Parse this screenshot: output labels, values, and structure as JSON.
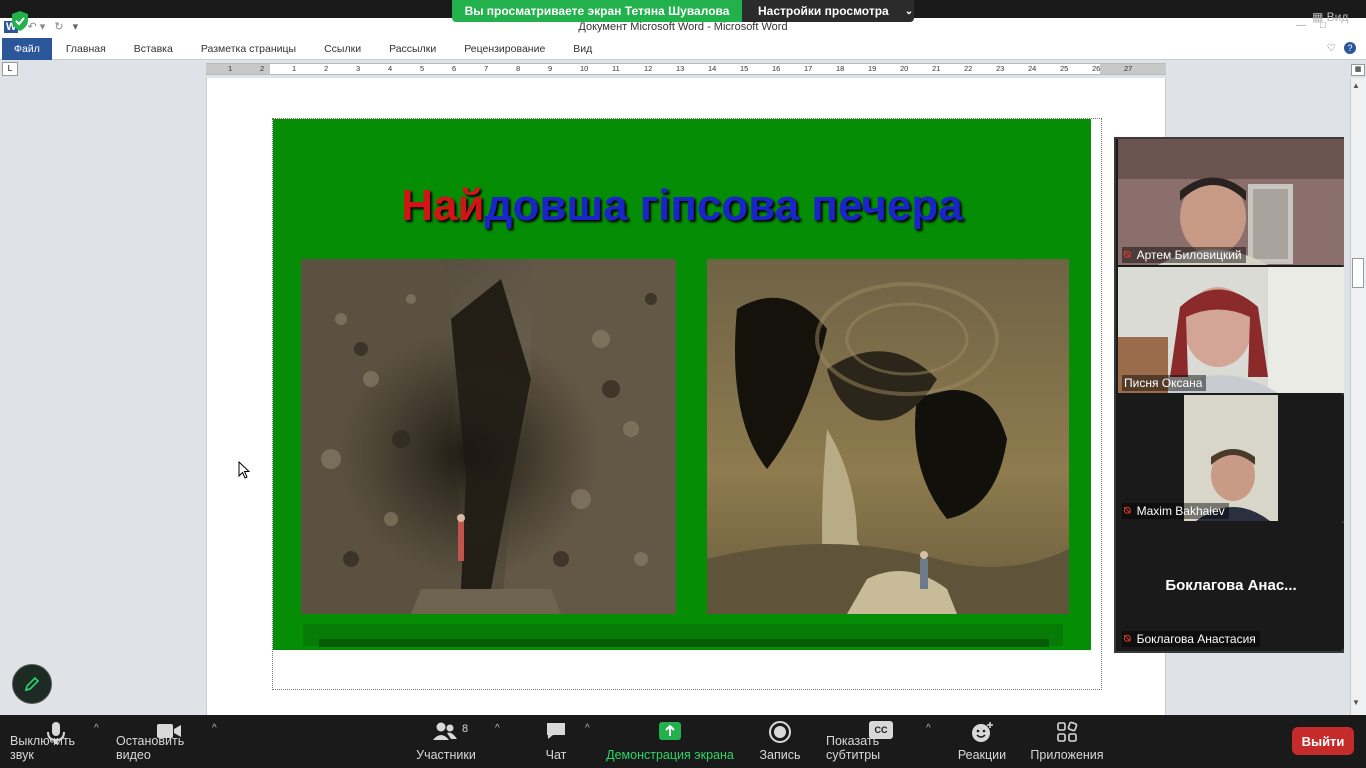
{
  "zoom": {
    "banner": {
      "sharing_text": "Вы просматриваете экран Тетяна Шувалова",
      "view_options": "Настройки просмотра",
      "view_label": "Вид"
    },
    "toolbar": {
      "mute": "Выключить звук",
      "stop_video": "Остановить видео",
      "participants": "Участники",
      "participants_count": "8",
      "chat": "Чат",
      "share_screen": "Демонстрация экрана",
      "record": "Запись",
      "captions": "Показать субтитры",
      "captions_icon_text": "CC",
      "reactions": "Реакции",
      "apps": "Приложения",
      "leave": "Выйти"
    },
    "participants": [
      {
        "name": "Артем Биловицкий",
        "muted": true
      },
      {
        "name": "Писня Оксана",
        "muted": false
      },
      {
        "name": "Maxim Bakhaiev",
        "muted": true
      },
      {
        "name": "Боклагова Анастасия",
        "muted": true,
        "display_name": "Боклагова  Анас..."
      }
    ]
  },
  "word": {
    "window_title": "Документ Microsoft Word  -  Microsoft Word",
    "tabs": [
      "Файл",
      "Главная",
      "Вставка",
      "Разметка страницы",
      "Ссылки",
      "Рассылки",
      "Рецензирование",
      "Вид"
    ],
    "ruler_numbers": [
      "1",
      "2",
      "1",
      "2",
      "3",
      "4",
      "5",
      "6",
      "7",
      "8",
      "9",
      "10",
      "11",
      "12",
      "13",
      "14",
      "15",
      "16",
      "17",
      "18",
      "19",
      "20",
      "21",
      "22",
      "23",
      "24",
      "25",
      "26",
      "27"
    ],
    "slide": {
      "title_red": "Най",
      "title_blue": "довша гіпсова печера",
      "background": "#058d05"
    }
  },
  "colors": {
    "share_green": "#23b14d",
    "leave_red": "#c52b2b",
    "word_blue": "#2b579a",
    "title_red": "#d01515",
    "title_blue": "#1a25c8"
  }
}
